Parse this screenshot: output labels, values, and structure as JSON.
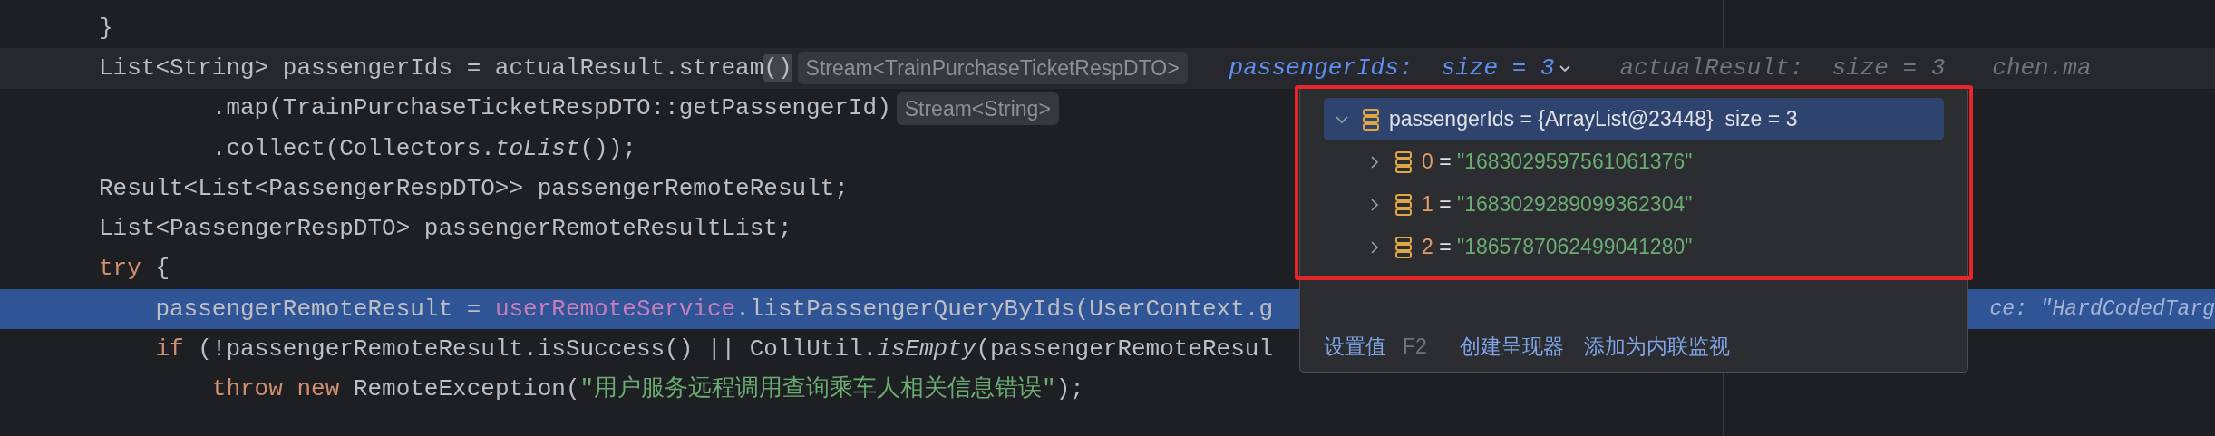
{
  "editor": {
    "lines": [
      {
        "tokens": [
          {
            "text": "}",
            "kind": "plain"
          }
        ]
      },
      {
        "tokens": [
          {
            "text": "List<String> passengerIds = actualResult.stream",
            "kind": "plain"
          },
          {
            "text": "()",
            "kind": "brace_match"
          }
        ],
        "hint": "Stream<TrainPurchaseTicketRespDTO>",
        "current": true,
        "inline_values": [
          {
            "name": "passengerIds:",
            "value": "size = 3",
            "selected": true
          },
          {
            "name": "actualResult:",
            "value": "size = 3",
            "selected": false
          },
          {
            "name": "chen.ma",
            "selected": false
          }
        ]
      },
      {
        "tokens": [
          {
            "text": "        .map(TrainPurchaseTicketRespDTO::getPassengerId)",
            "kind": "plain"
          }
        ],
        "hint": "Stream<String>"
      },
      {
        "tokens": [
          {
            "text": "        .collect(Collectors.",
            "kind": "plain"
          },
          {
            "text": "toList",
            "kind": "static"
          },
          {
            "text": "());",
            "kind": "plain"
          }
        ]
      },
      {
        "tokens": [
          {
            "text": "Result<List<PassengerRespDTO>> passengerRemoteResult;",
            "kind": "plain"
          }
        ]
      },
      {
        "tokens": [
          {
            "text": "List<PassengerRespDTO> passengerRemoteResultList;",
            "kind": "plain"
          }
        ]
      },
      {
        "tokens": [
          {
            "text": "try",
            "kind": "keyword"
          },
          {
            "text": " {",
            "kind": "plain"
          }
        ]
      },
      {
        "tokens": [
          {
            "text": "    passengerRemoteResult = ",
            "kind": "plain"
          },
          {
            "text": "userRemoteService",
            "kind": "field"
          },
          {
            "text": ".listPassengerQueryByIds(UserContext.g",
            "kind": "plain"
          }
        ],
        "execution": true,
        "trailing_value": "ce: \"HardCodedTarg"
      },
      {
        "tokens": [
          {
            "text": "    if",
            "kind": "keyword"
          },
          {
            "text": " (!passengerRemoteResult.isSuccess() || CollUtil.",
            "kind": "plain"
          },
          {
            "text": "isEmpty",
            "kind": "static"
          },
          {
            "text": "(passengerRemoteResul",
            "kind": "plain"
          }
        ]
      },
      {
        "tokens": [
          {
            "text": "        throw",
            "kind": "keyword"
          },
          {
            "text": " new",
            "kind": "keyword"
          },
          {
            "text": " RemoteException(",
            "kind": "plain"
          },
          {
            "text": "\"用户服务远程调用查询乘车人相关信息错误\"",
            "kind": "string"
          },
          {
            "text": ");",
            "kind": "plain"
          }
        ]
      }
    ]
  },
  "popup": {
    "annotated": true,
    "tree": [
      {
        "name": "passengerIds",
        "separator": "=",
        "value": "{ArrayList@23448}",
        "extra": "size = 3",
        "kind": "collection",
        "expanded": true,
        "selected": true,
        "children": [
          {
            "name": "0",
            "separator": "=",
            "value": "\"1683029597561061376\"",
            "kind": "element",
            "expanded": false,
            "selected": false
          },
          {
            "name": "1",
            "separator": "=",
            "value": "\"1683029289099362304\"",
            "kind": "element",
            "expanded": false,
            "selected": false
          },
          {
            "name": "2",
            "separator": "=",
            "value": "\"1865787062499041280\"",
            "kind": "element",
            "expanded": false,
            "selected": false
          }
        ]
      }
    ],
    "actions": [
      {
        "label": "设置值",
        "shortcut": "F2"
      },
      {
        "label": "创建呈现器"
      },
      {
        "label": "添加为内联监视"
      }
    ]
  }
}
